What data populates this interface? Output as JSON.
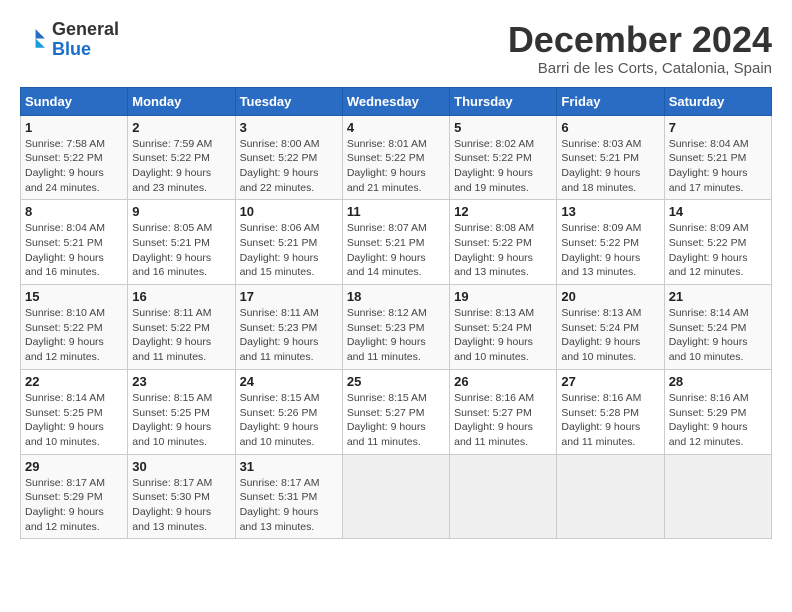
{
  "header": {
    "logo_general": "General",
    "logo_blue": "Blue",
    "title": "December 2024",
    "subtitle": "Barri de les Corts, Catalonia, Spain"
  },
  "calendar": {
    "days_of_week": [
      "Sunday",
      "Monday",
      "Tuesday",
      "Wednesday",
      "Thursday",
      "Friday",
      "Saturday"
    ],
    "weeks": [
      [
        {
          "day": "",
          "info": ""
        },
        {
          "day": "2",
          "info": "Sunrise: 7:59 AM\nSunset: 5:22 PM\nDaylight: 9 hours and 23 minutes."
        },
        {
          "day": "3",
          "info": "Sunrise: 8:00 AM\nSunset: 5:22 PM\nDaylight: 9 hours and 22 minutes."
        },
        {
          "day": "4",
          "info": "Sunrise: 8:01 AM\nSunset: 5:22 PM\nDaylight: 9 hours and 21 minutes."
        },
        {
          "day": "5",
          "info": "Sunrise: 8:02 AM\nSunset: 5:22 PM\nDaylight: 9 hours and 19 minutes."
        },
        {
          "day": "6",
          "info": "Sunrise: 8:03 AM\nSunset: 5:21 PM\nDaylight: 9 hours and 18 minutes."
        },
        {
          "day": "7",
          "info": "Sunrise: 8:04 AM\nSunset: 5:21 PM\nDaylight: 9 hours and 17 minutes."
        }
      ],
      [
        {
          "day": "8",
          "info": "Sunrise: 8:04 AM\nSunset: 5:21 PM\nDaylight: 9 hours and 16 minutes."
        },
        {
          "day": "9",
          "info": "Sunrise: 8:05 AM\nSunset: 5:21 PM\nDaylight: 9 hours and 16 minutes."
        },
        {
          "day": "10",
          "info": "Sunrise: 8:06 AM\nSunset: 5:21 PM\nDaylight: 9 hours and 15 minutes."
        },
        {
          "day": "11",
          "info": "Sunrise: 8:07 AM\nSunset: 5:21 PM\nDaylight: 9 hours and 14 minutes."
        },
        {
          "day": "12",
          "info": "Sunrise: 8:08 AM\nSunset: 5:22 PM\nDaylight: 9 hours and 13 minutes."
        },
        {
          "day": "13",
          "info": "Sunrise: 8:09 AM\nSunset: 5:22 PM\nDaylight: 9 hours and 13 minutes."
        },
        {
          "day": "14",
          "info": "Sunrise: 8:09 AM\nSunset: 5:22 PM\nDaylight: 9 hours and 12 minutes."
        }
      ],
      [
        {
          "day": "15",
          "info": "Sunrise: 8:10 AM\nSunset: 5:22 PM\nDaylight: 9 hours and 12 minutes."
        },
        {
          "day": "16",
          "info": "Sunrise: 8:11 AM\nSunset: 5:22 PM\nDaylight: 9 hours and 11 minutes."
        },
        {
          "day": "17",
          "info": "Sunrise: 8:11 AM\nSunset: 5:23 PM\nDaylight: 9 hours and 11 minutes."
        },
        {
          "day": "18",
          "info": "Sunrise: 8:12 AM\nSunset: 5:23 PM\nDaylight: 9 hours and 11 minutes."
        },
        {
          "day": "19",
          "info": "Sunrise: 8:13 AM\nSunset: 5:24 PM\nDaylight: 9 hours and 10 minutes."
        },
        {
          "day": "20",
          "info": "Sunrise: 8:13 AM\nSunset: 5:24 PM\nDaylight: 9 hours and 10 minutes."
        },
        {
          "day": "21",
          "info": "Sunrise: 8:14 AM\nSunset: 5:24 PM\nDaylight: 9 hours and 10 minutes."
        }
      ],
      [
        {
          "day": "22",
          "info": "Sunrise: 8:14 AM\nSunset: 5:25 PM\nDaylight: 9 hours and 10 minutes."
        },
        {
          "day": "23",
          "info": "Sunrise: 8:15 AM\nSunset: 5:25 PM\nDaylight: 9 hours and 10 minutes."
        },
        {
          "day": "24",
          "info": "Sunrise: 8:15 AM\nSunset: 5:26 PM\nDaylight: 9 hours and 10 minutes."
        },
        {
          "day": "25",
          "info": "Sunrise: 8:15 AM\nSunset: 5:27 PM\nDaylight: 9 hours and 11 minutes."
        },
        {
          "day": "26",
          "info": "Sunrise: 8:16 AM\nSunset: 5:27 PM\nDaylight: 9 hours and 11 minutes."
        },
        {
          "day": "27",
          "info": "Sunrise: 8:16 AM\nSunset: 5:28 PM\nDaylight: 9 hours and 11 minutes."
        },
        {
          "day": "28",
          "info": "Sunrise: 8:16 AM\nSunset: 5:29 PM\nDaylight: 9 hours and 12 minutes."
        }
      ],
      [
        {
          "day": "29",
          "info": "Sunrise: 8:17 AM\nSunset: 5:29 PM\nDaylight: 9 hours and 12 minutes."
        },
        {
          "day": "30",
          "info": "Sunrise: 8:17 AM\nSunset: 5:30 PM\nDaylight: 9 hours and 13 minutes."
        },
        {
          "day": "31",
          "info": "Sunrise: 8:17 AM\nSunset: 5:31 PM\nDaylight: 9 hours and 13 minutes."
        },
        {
          "day": "",
          "info": ""
        },
        {
          "day": "",
          "info": ""
        },
        {
          "day": "",
          "info": ""
        },
        {
          "day": "",
          "info": ""
        }
      ]
    ],
    "first_day_num": "1",
    "first_day_info": "Sunrise: 7:58 AM\nSunset: 5:22 PM\nDaylight: 9 hours and 24 minutes."
  }
}
